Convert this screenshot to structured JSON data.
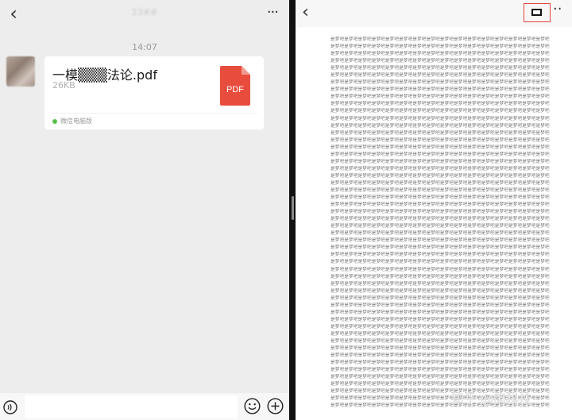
{
  "left_header": {
    "back_glyph": "‹",
    "chat_title": "23##",
    "more_glyph": "···"
  },
  "message": {
    "timestamp": "14:07",
    "file_name": "一模▒▒▒法论.pdf",
    "file_size": "26KB",
    "file_icon_label": "PDF",
    "source_label": "微信电脑版"
  },
  "input_bar": {
    "value": "",
    "voice_icon": "voice-icon",
    "emoji_icon": "emoji-icon",
    "plus_icon": "plus-icon"
  },
  "right_header": {
    "back_glyph": "‹",
    "fullscreen_icon": "fullscreen-icon",
    "more_glyph": "··"
  },
  "document": {
    "line_text": "是梦吧是梦吧是梦吧是梦吧是梦吧是梦吧是梦吧是梦吧是梦吧是梦吧是梦吧是梦吧是梦吧是梦吧是梦吧是梦吧",
    "line_count": 52
  },
  "watermark": "知乎 @简科技",
  "colors": {
    "chat_bg": "#ededed",
    "pdf_red": "#e84c3d",
    "highlight_red": "#e0463a",
    "source_green": "#58c14b"
  }
}
